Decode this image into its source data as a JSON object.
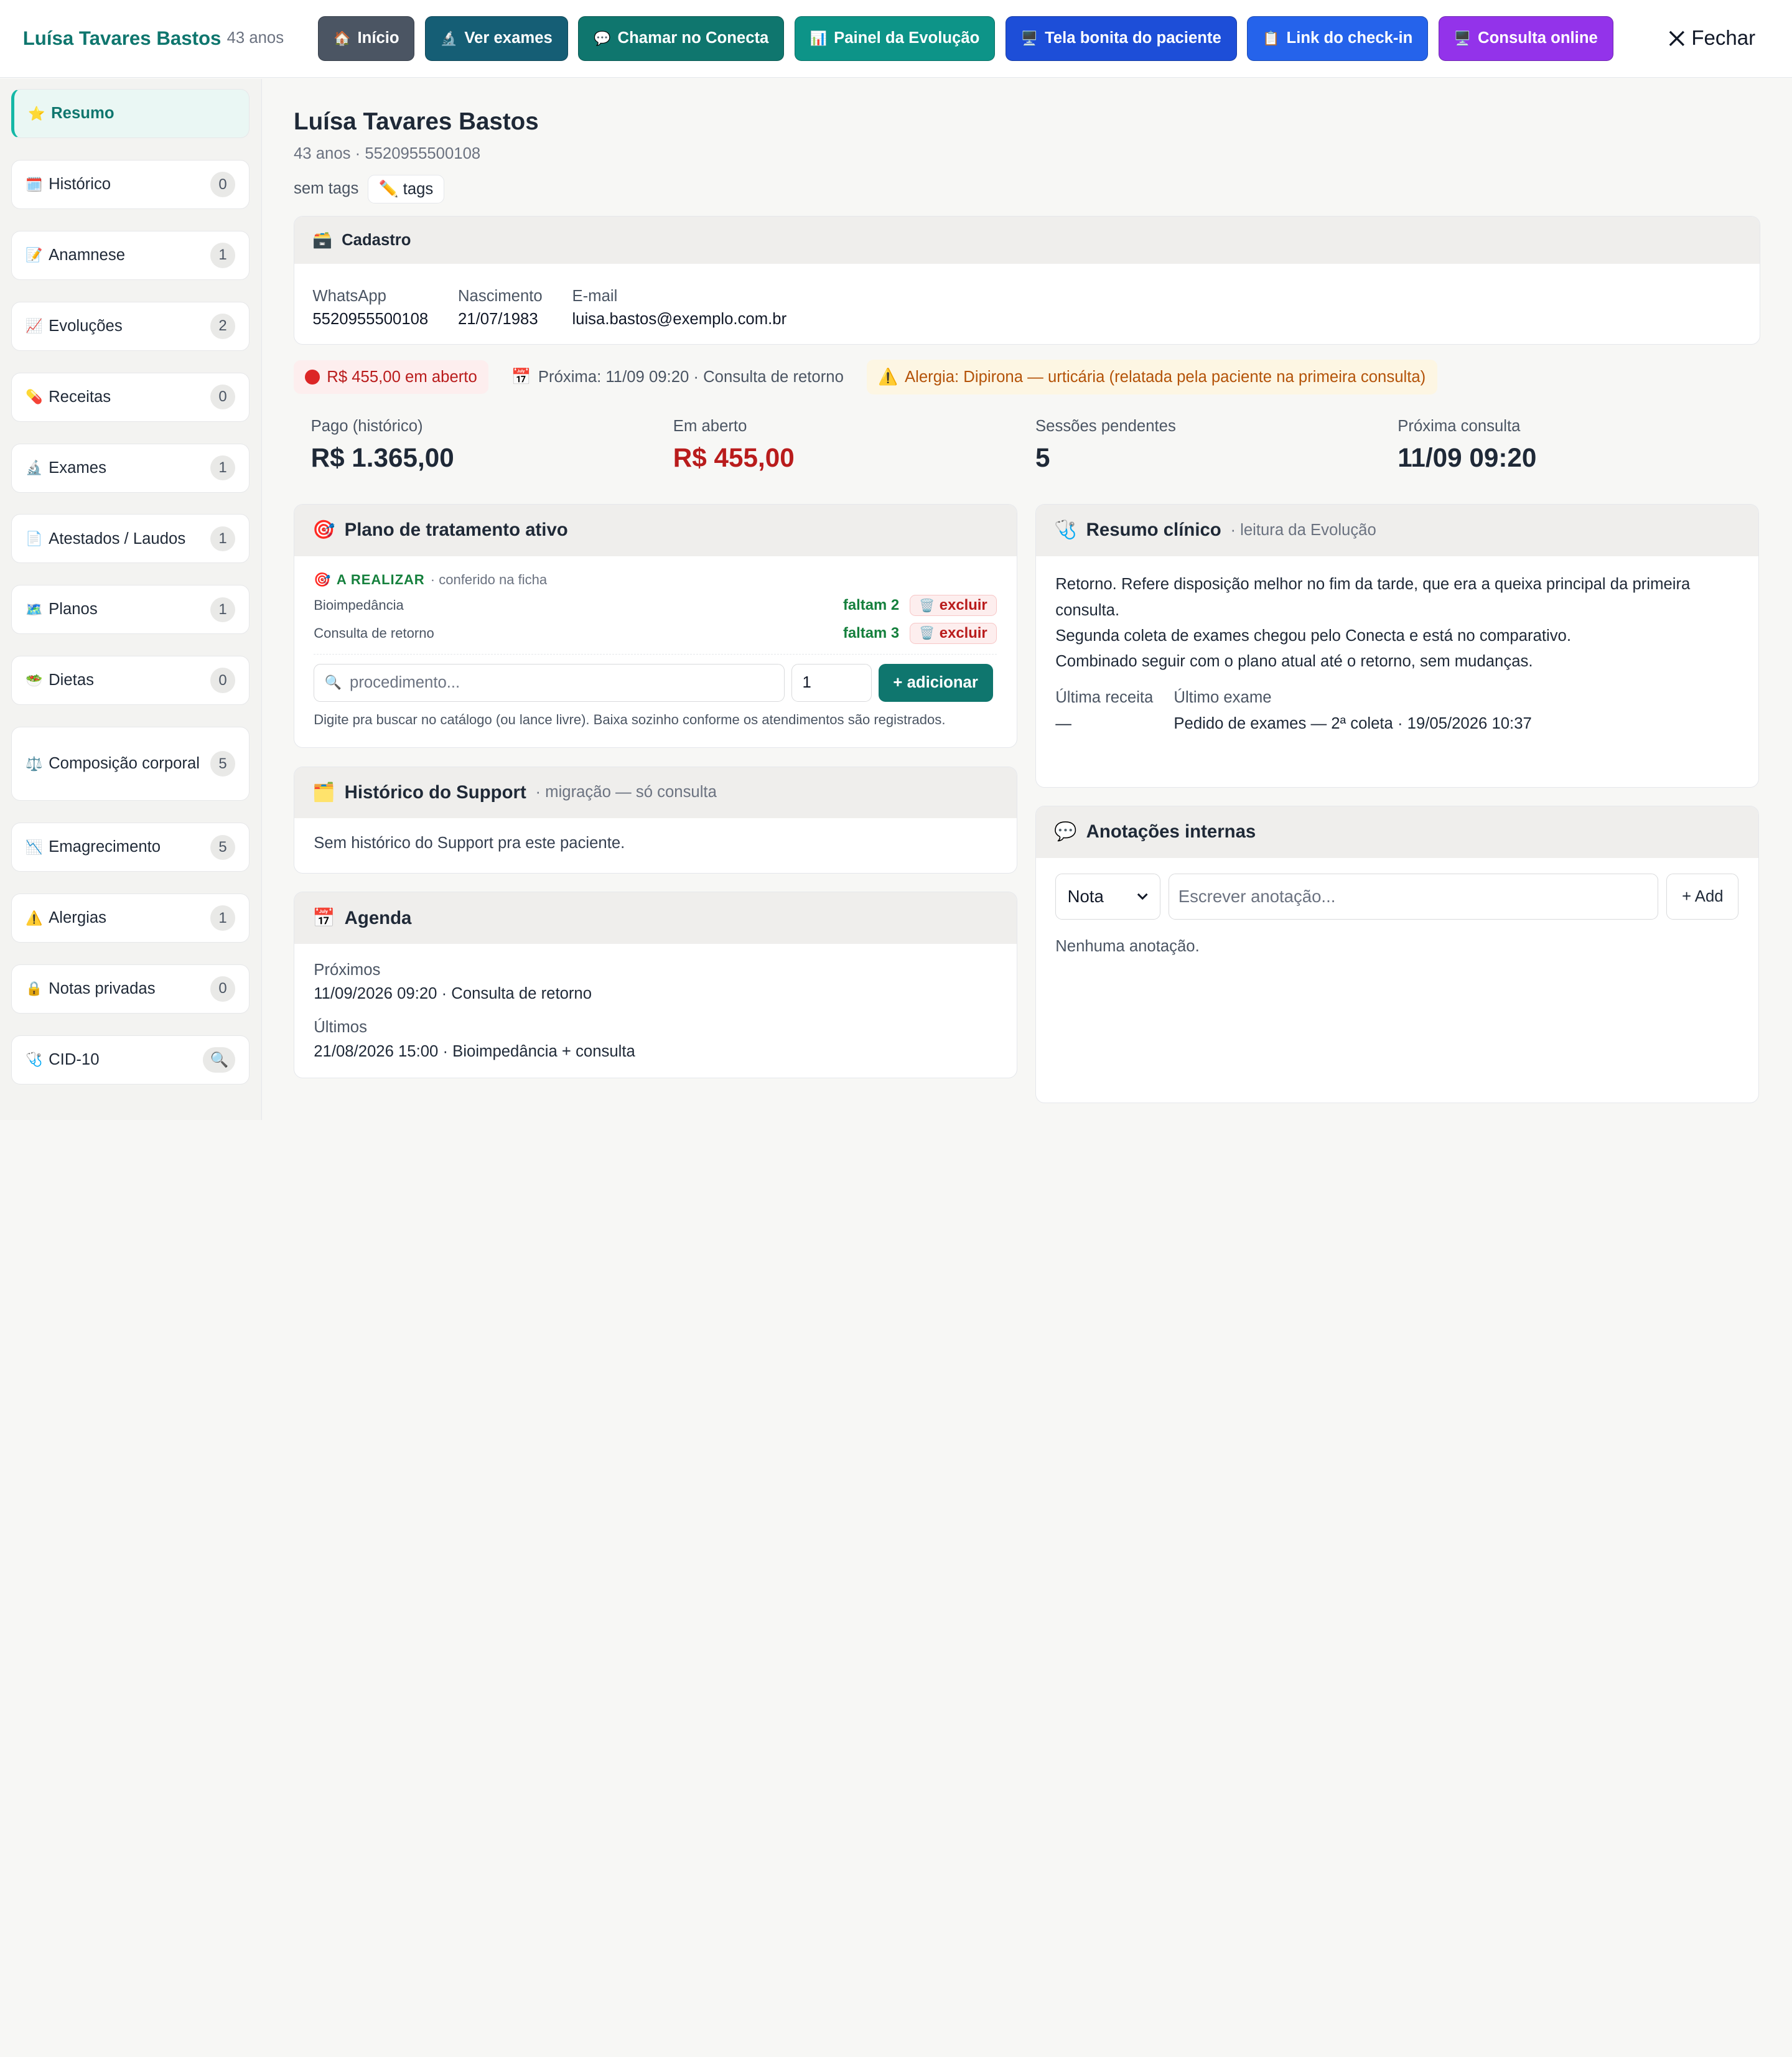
{
  "header": {
    "patient_name": "Luísa Tavares Bastos",
    "age": "43 anos",
    "buttons": [
      {
        "label": "Início",
        "icon": "🏠",
        "color": "#4b5563"
      },
      {
        "label": "Ver exames",
        "icon": "🔬",
        "color": "#155e75"
      },
      {
        "label": "Chamar no Conecta",
        "icon": "💬",
        "color": "#0f766e"
      },
      {
        "label": "Painel da Evolução",
        "icon": "📊",
        "color": "#0d9488"
      },
      {
        "label": "Tela bonita do paciente",
        "icon": "🖥️",
        "color": "#1d4ed8"
      },
      {
        "label": "Link do check-in",
        "icon": "📋",
        "color": "#2563eb"
      },
      {
        "label": "Consulta online",
        "icon": "🖥️",
        "color": "#9333ea"
      }
    ],
    "close_label": "Fechar"
  },
  "sidebar": {
    "items": [
      {
        "label": "Resumo",
        "icon": "⭐",
        "count": ""
      },
      {
        "label": "Histórico",
        "icon": "🗓️",
        "count": "0"
      },
      {
        "label": "Anamnese",
        "icon": "📝",
        "count": "1"
      },
      {
        "label": "Evoluções",
        "icon": "📈",
        "count": "2"
      },
      {
        "label": "Receitas",
        "icon": "💊",
        "count": "0"
      },
      {
        "label": "Exames",
        "icon": "🔬",
        "count": "1"
      },
      {
        "label": "Atestados / Laudos",
        "icon": "📄",
        "count": "1"
      },
      {
        "label": "Planos",
        "icon": "🗺️",
        "count": "1"
      },
      {
        "label": "Dietas",
        "icon": "🥗",
        "count": "0"
      },
      {
        "label": "Composição corporal",
        "icon": "⚖️",
        "count": "5"
      },
      {
        "label": "Emagrecimento",
        "icon": "📉",
        "count": "5"
      },
      {
        "label": "Alergias",
        "icon": "⚠️",
        "count": "1"
      },
      {
        "label": "Notas privadas",
        "icon": "🔒",
        "count": "0"
      },
      {
        "label": "CID-10",
        "icon": "🩺",
        "count": "🔍"
      }
    ]
  },
  "main": {
    "title": "Luísa Tavares Bastos",
    "subtitle": "43 anos · 5520955500108",
    "tags_label": "sem tags",
    "tags_button": "tags",
    "tags_icon": "✏️",
    "cadastro": {
      "title": "Cadastro",
      "icon": "🗃️",
      "fields": [
        {
          "label": "WhatsApp",
          "value": "5520955500108"
        },
        {
          "label": "Nascimento",
          "value": "21/07/1983"
        },
        {
          "label": "E-mail",
          "value": "luisa.bastos@exemplo.com.br"
        }
      ]
    },
    "alerts": {
      "open_amount": "R$ 455,00 em aberto",
      "next": "Próxima: 11/09 09:20 · Consulta de retorno",
      "next_icon": "📅",
      "allergy": "Alergia: Dipirona — urticária (relatada pela paciente na primeira consulta)",
      "allergy_icon": "⚠️"
    },
    "stats": [
      {
        "label": "Pago (histórico)",
        "value": "R$ 1.365,00"
      },
      {
        "label": "Em aberto",
        "value": "R$ 455,00"
      },
      {
        "label": "Sessões pendentes",
        "value": "5"
      },
      {
        "label": "Próxima consulta",
        "value": "11/09 09:20"
      }
    ],
    "plano": {
      "title": "Plano de tratamento ativo",
      "icon": "🎯",
      "status": "A REALIZAR",
      "status_note": "· conferido na ficha",
      "rows": [
        {
          "name": "Bioimpedância",
          "remaining": "faltam 2",
          "action": "excluir"
        },
        {
          "name": "Consulta de retorno",
          "remaining": "faltam 3",
          "action": "excluir"
        }
      ],
      "search_placeholder": "procedimento...",
      "qty": "1",
      "add_label": "+ adicionar",
      "hint": "Digite pra buscar no catálogo (ou lance livre). Baixa sozinho conforme os atendimentos são registrados."
    },
    "support": {
      "title": "Histórico do Support",
      "subtitle": "· migração — só consulta",
      "icon": "🗂️",
      "text": "Sem histórico do Support pra este paciente."
    },
    "agenda": {
      "title": "Agenda",
      "icon": "📅",
      "next_label": "Próximos",
      "next_value": "11/09/2026 09:20 · Consulta de retorno",
      "last_label": "Últimos",
      "last_value": "21/08/2026 15:00 · Bioimpedância + consulta"
    },
    "resumo_clinico": {
      "title": "Resumo clínico",
      "subtitle": "· leitura da Evolução",
      "icon": "🩺",
      "lines": [
        "Retorno. Refere disposição melhor no fim da tarde, que era a queixa principal da primeira consulta.",
        "Segunda coleta de exames chegou pelo Conecta e está no comparativo.",
        "Combinado seguir com o plano atual até o retorno, sem mudanças."
      ],
      "last_recipe_label": "Última receita",
      "last_recipe_value": "—",
      "last_exam_label": "Último exame",
      "last_exam_value": "Pedido de exames — 2ª coleta · 19/05/2026 10:37"
    },
    "anotacoes": {
      "title": "Anotações internas",
      "icon": "💬",
      "type_selected": "Nota",
      "placeholder": "Escrever anotação...",
      "add_label": "+ Add",
      "empty": "Nenhuma anotação."
    }
  }
}
